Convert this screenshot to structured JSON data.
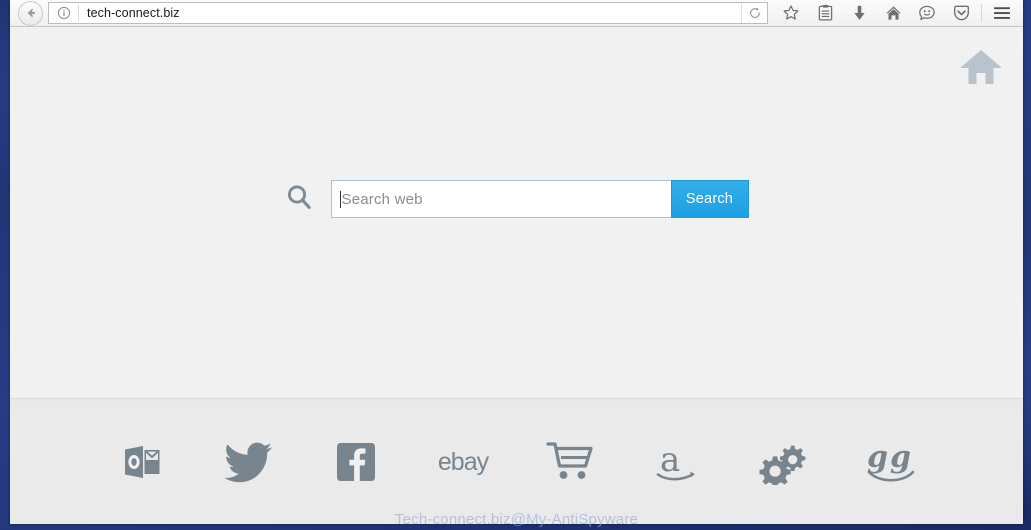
{
  "browser": {
    "back_button": "back-arrow",
    "identity_icon": "info-circle",
    "url": "tech-connect.biz",
    "reload_button": "reload",
    "toolbar_icons": [
      {
        "name": "bookmark-star-icon",
        "label": "Bookmark"
      },
      {
        "name": "library-icon",
        "label": "Library"
      },
      {
        "name": "downloads-icon",
        "label": "Downloads"
      },
      {
        "name": "home-icon",
        "label": "Home"
      },
      {
        "name": "sync-smiley-icon",
        "label": "Sync"
      },
      {
        "name": "pocket-icon",
        "label": "Pocket"
      },
      {
        "name": "menu-icon",
        "label": "Open menu"
      }
    ]
  },
  "page": {
    "home_icon": "house-icon",
    "search": {
      "magnifier_icon": "magnifier-icon",
      "placeholder": "Search web",
      "value": "",
      "button_label": "Search",
      "button_color": "#1fa0e2",
      "border_color": "#a9c3d4"
    }
  },
  "footer": {
    "icon_color": "#78858f",
    "shortcuts": [
      {
        "name": "outlook-icon",
        "label": "Outlook"
      },
      {
        "name": "twitter-icon",
        "label": "Twitter"
      },
      {
        "name": "facebook-icon",
        "label": "Facebook"
      },
      {
        "name": "ebay-icon",
        "label": "ebay"
      },
      {
        "name": "shopping-cart-icon",
        "label": "Shopping"
      },
      {
        "name": "amazon-icon",
        "label": "Amazon"
      },
      {
        "name": "gears-icon",
        "label": "Tools"
      },
      {
        "name": "goodreads-gg-icon",
        "label": "gg"
      }
    ],
    "watermark": "Tech-connect.biz@My-AntiSpyware"
  }
}
